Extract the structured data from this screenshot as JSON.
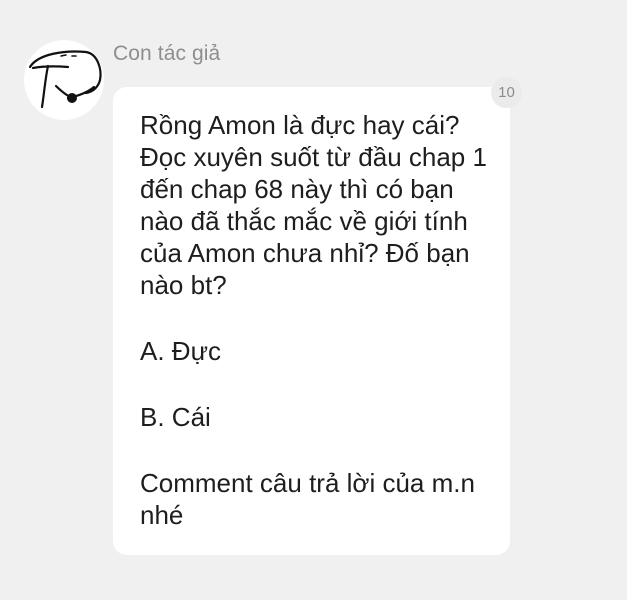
{
  "comment": {
    "author": "Con tác giả",
    "avatar_icon": "doodle-face-icon",
    "reaction_count": "10",
    "paragraphs": [
      "Rồng Amon là đực hay cái? Đọc xuyên suốt từ đầu chap 1 đến chap 68 này thì có bạn nào đã thắc mắc về giới tính của Amon chưa nhỉ? Đố bạn nào bt?",
      "A. Đực",
      "B. Cái",
      "Comment câu trả lời của m.n nhé"
    ]
  }
}
